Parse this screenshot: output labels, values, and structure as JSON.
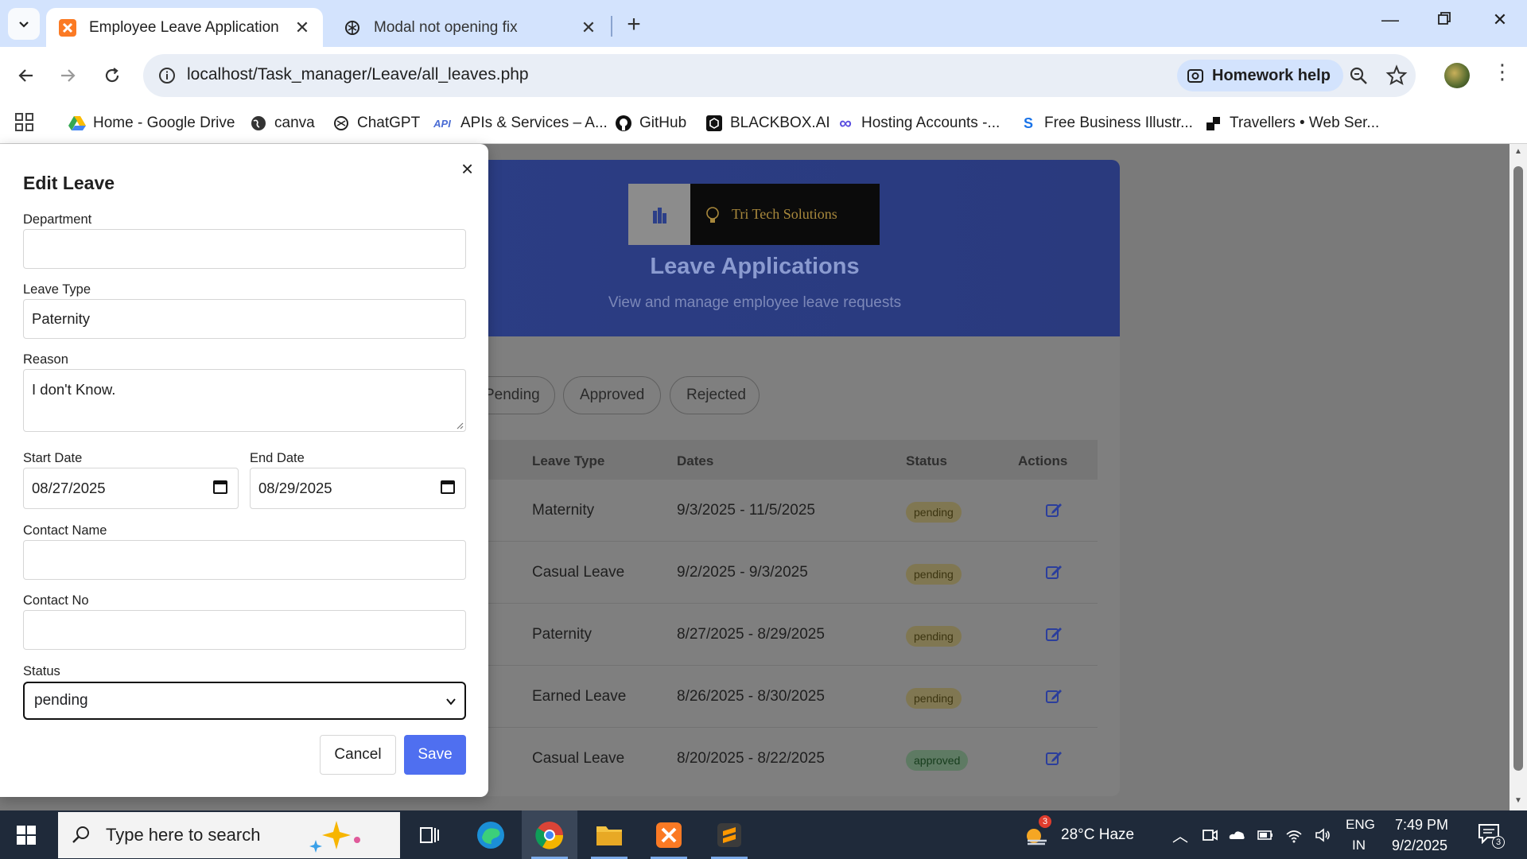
{
  "browser": {
    "tabs": [
      {
        "title": "Employee Leave Application",
        "active": true
      },
      {
        "title": "Modal not opening fix",
        "active": false
      }
    ],
    "url": "localhost/Task_manager/Leave/all_leaves.php",
    "homework_help": "Homework help",
    "bookmarks": [
      "Home - Google Drive",
      "canva",
      "ChatGPT",
      "APIs & Services – A...",
      "GitHub",
      "BLACKBOX.AI",
      "Hosting Accounts -...",
      "Free Business Illustr...",
      "Travellers • Web Ser..."
    ]
  },
  "page": {
    "logo_text": "Tri Tech Solutions",
    "title": "Leave Applications",
    "subtitle": "View and manage employee leave requests",
    "filters": [
      "Pending",
      "Approved",
      "Rejected"
    ],
    "columns": [
      "Leave Type",
      "Dates",
      "Status",
      "Actions"
    ],
    "rows": [
      {
        "type": "Maternity",
        "dates": "9/3/2025 - 11/5/2025",
        "status": "pending"
      },
      {
        "type": "Casual Leave",
        "dates": "9/2/2025 - 9/3/2025",
        "status": "pending"
      },
      {
        "type": "Paternity",
        "dates": "8/27/2025 - 8/29/2025",
        "status": "pending"
      },
      {
        "type": "Earned Leave",
        "dates": "8/26/2025 - 8/30/2025",
        "status": "pending"
      },
      {
        "type": "Casual Leave",
        "dates": "8/20/2025 - 8/22/2025",
        "status": "approved"
      }
    ]
  },
  "modal": {
    "title": "Edit Leave",
    "close": "×",
    "department_label": "Department",
    "department_value": "",
    "leave_type_label": "Leave Type",
    "leave_type_value": "Paternity",
    "reason_label": "Reason",
    "reason_value": "I don't Know.",
    "start_date_label": "Start Date",
    "start_date_value": "08/27/2025",
    "end_date_label": "End Date",
    "end_date_value": "08/29/2025",
    "contact_name_label": "Contact Name",
    "contact_name_value": "",
    "contact_no_label": "Contact No",
    "contact_no_value": "",
    "status_label": "Status",
    "status_value": "pending",
    "cancel": "Cancel",
    "save": "Save"
  },
  "taskbar": {
    "search_placeholder": "Type here to search",
    "weather": "28°C  Haze",
    "weather_badge": "3",
    "lang_top": "ENG",
    "lang_bottom": "IN",
    "time": "7:49 PM",
    "date": "9/2/2025",
    "notif_count": "3"
  },
  "colors": {
    "accent": "#4f6ff0",
    "tabstrip": "#d3e3fd",
    "hero": "#2c3f88",
    "taskbar": "#1f2a3a"
  }
}
